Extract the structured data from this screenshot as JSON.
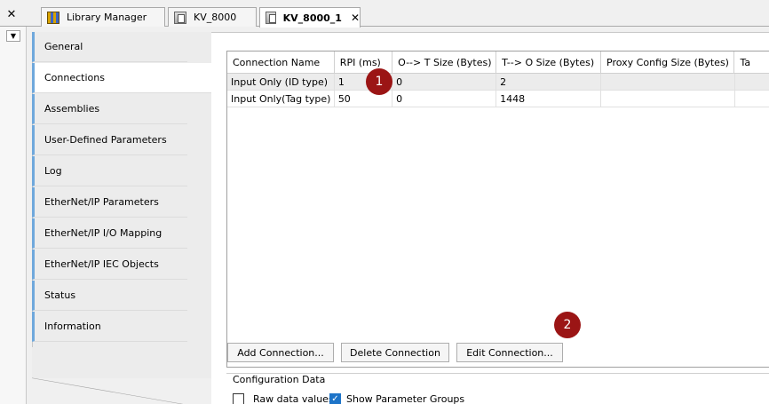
{
  "tabstrip": {
    "close_all": "✕",
    "tabs": [
      {
        "label": "Library Manager"
      },
      {
        "label": "KV_8000"
      },
      {
        "label": "KV_8000_1",
        "close": "✕"
      }
    ]
  },
  "left_pane": {
    "dropdown": "▼"
  },
  "nav": {
    "items": [
      {
        "label": "General"
      },
      {
        "label": "Connections"
      },
      {
        "label": "Assemblies"
      },
      {
        "label": "User-Defined Parameters"
      },
      {
        "label": "Log"
      },
      {
        "label": "EtherNet/IP Parameters"
      },
      {
        "label": "EtherNet/IP I/O Mapping"
      },
      {
        "label": "EtherNet/IP IEC Objects"
      },
      {
        "label": "Status"
      },
      {
        "label": "Information"
      }
    ]
  },
  "grid": {
    "columns": [
      "Connection Name",
      "RPI (ms)",
      "O--> T Size (Bytes)",
      "T--> O Size (Bytes)",
      "Proxy Config Size (Bytes)",
      "Ta"
    ],
    "rows": [
      [
        "Input Only (ID type)",
        "1",
        "0",
        "2",
        "",
        ""
      ],
      [
        "Input Only(Tag type)",
        "50",
        "0",
        "1448",
        "",
        ""
      ]
    ]
  },
  "buttons": {
    "add": "Add Connection...",
    "delete": "Delete Connection",
    "edit": "Edit Connection..."
  },
  "config": {
    "title": "Configuration Data",
    "raw_data_label": "Raw data values",
    "raw_data_checked": false,
    "show_groups_label": "Show Parameter Groups",
    "show_groups_checked": true,
    "check_mark": "✓"
  },
  "markers": [
    "1",
    "2"
  ],
  "colors": {
    "marker": "#9b1515",
    "accent": "#6fa8dc",
    "checkbox": "#1e74c8"
  }
}
